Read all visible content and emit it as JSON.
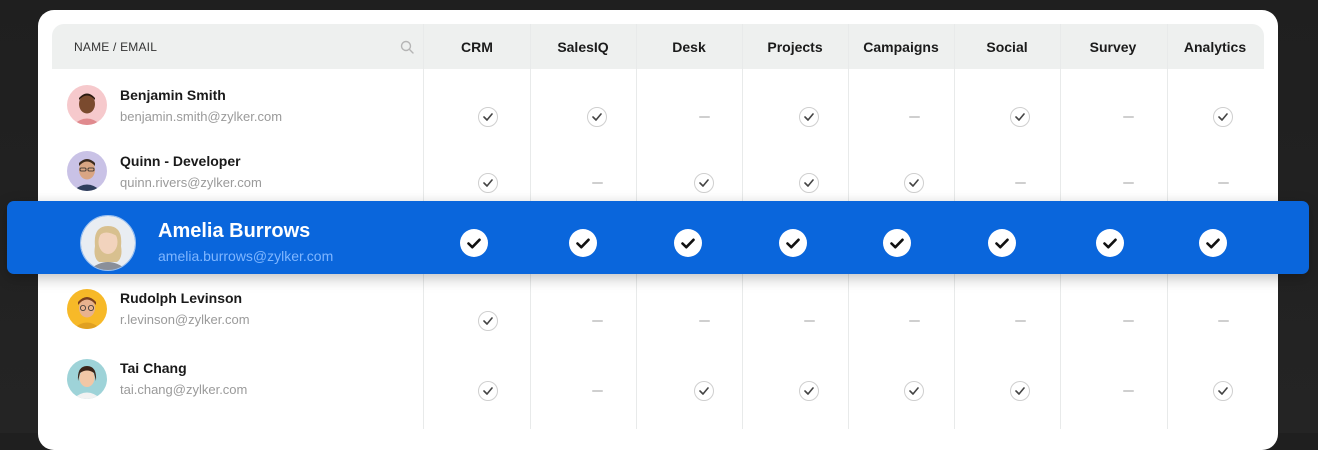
{
  "header": {
    "name_label": "NAME / EMAIL",
    "apps": [
      "CRM",
      "SalesIQ",
      "Desk",
      "Projects",
      "Campaigns",
      "Social",
      "Survey",
      "Analytics"
    ]
  },
  "users": [
    {
      "name": "Benjamin Smith",
      "email": "benjamin.smith@zylker.com",
      "access": [
        true,
        true,
        false,
        true,
        false,
        true,
        false,
        true
      ]
    },
    {
      "name": "Quinn - Developer",
      "email": "quinn.rivers@zylker.com",
      "access": [
        true,
        false,
        true,
        true,
        true,
        false,
        false,
        false
      ]
    },
    {
      "name": "Rudolph Levinson",
      "email": "r.levinson@zylker.com",
      "access": [
        true,
        false,
        false,
        false,
        false,
        false,
        false,
        false
      ]
    },
    {
      "name": "Tai Chang",
      "email": "tai.chang@zylker.com",
      "access": [
        true,
        false,
        true,
        true,
        true,
        true,
        false,
        true
      ]
    }
  ],
  "highlighted_user": {
    "name": "Amelia Burrows",
    "email": "amelia.burrows@zylker.com",
    "access": [
      true,
      true,
      true,
      true,
      true,
      true,
      true,
      true
    ]
  },
  "colors": {
    "highlight": "#0a66dc",
    "header_bg": "#eef0ef",
    "email_text": "#9a9a9a",
    "highlight_email": "#7fb6ff"
  }
}
